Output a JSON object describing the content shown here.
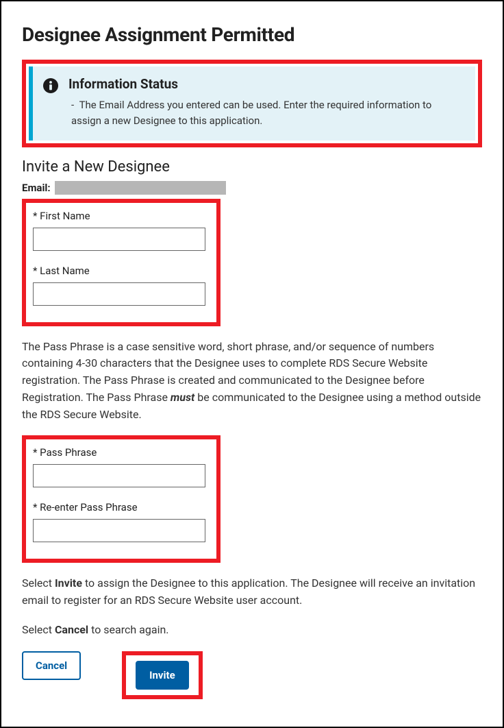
{
  "page": {
    "title": "Designee Assignment Permitted"
  },
  "alert": {
    "heading": "Information Status",
    "message": "The Email Address you entered can be used. Enter the required information to assign a new Designee to this application."
  },
  "section": {
    "title": "Invite a New Designee"
  },
  "form": {
    "email_label": "Email:",
    "first_name_label": "* First Name",
    "first_name_value": "",
    "last_name_label": "* Last Name",
    "last_name_value": "",
    "pass_phrase_label": "* Pass Phrase",
    "pass_phrase_value": "",
    "reenter_pass_phrase_label": "* Re-enter Pass Phrase",
    "reenter_pass_phrase_value": ""
  },
  "text": {
    "passphrase_help_pre": "The Pass Phrase is a case sensitive word, short phrase, and/or sequence of numbers containing 4-30 characters that the Designee uses to complete RDS Secure Website registration. The Pass Phrase is created and communicated to the Designee before Registration. The Pass Phrase ",
    "passphrase_help_must": "must",
    "passphrase_help_post": " be communicated to the Designee using a method outside the RDS Secure Website.",
    "invite_help_pre": "Select ",
    "invite_help_strong": "Invite",
    "invite_help_post": " to assign the Designee to this application. The Designee will receive an invitation email to register for an RDS Secure Website user account.",
    "cancel_help_pre": "Select ",
    "cancel_help_strong": "Cancel",
    "cancel_help_post": " to search again."
  },
  "buttons": {
    "cancel": "Cancel",
    "invite": "Invite"
  }
}
